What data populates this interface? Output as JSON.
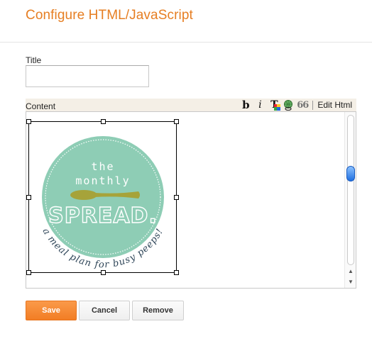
{
  "page": {
    "title": "Configure HTML/JavaScript"
  },
  "form": {
    "title_label": "Title",
    "title_value": "",
    "content_label": "Content"
  },
  "toolbar": {
    "items": [
      {
        "icon": "bold-icon",
        "glyph": "b"
      },
      {
        "icon": "italic-icon",
        "glyph": "i"
      },
      {
        "icon": "text-color-icon",
        "glyph": "T"
      },
      {
        "icon": "link-icon",
        "glyph": ""
      },
      {
        "icon": "quote-icon",
        "glyph": "66"
      }
    ],
    "edit_html_label": "Edit Html"
  },
  "editor": {
    "image": {
      "line1": "the",
      "line2": "monthly",
      "brand": "SPREAD.",
      "tagline": "a meal plan for busy peeps!",
      "colors": {
        "circle": "#8ecdb5",
        "spoon": "#a6a33a",
        "text": "#ffffff",
        "tagline": "#2d4457"
      }
    }
  },
  "actions": {
    "save_label": "Save",
    "cancel_label": "Cancel",
    "remove_label": "Remove"
  },
  "colors": {
    "accent": "#e67e22",
    "save_button": "#f27d24"
  }
}
